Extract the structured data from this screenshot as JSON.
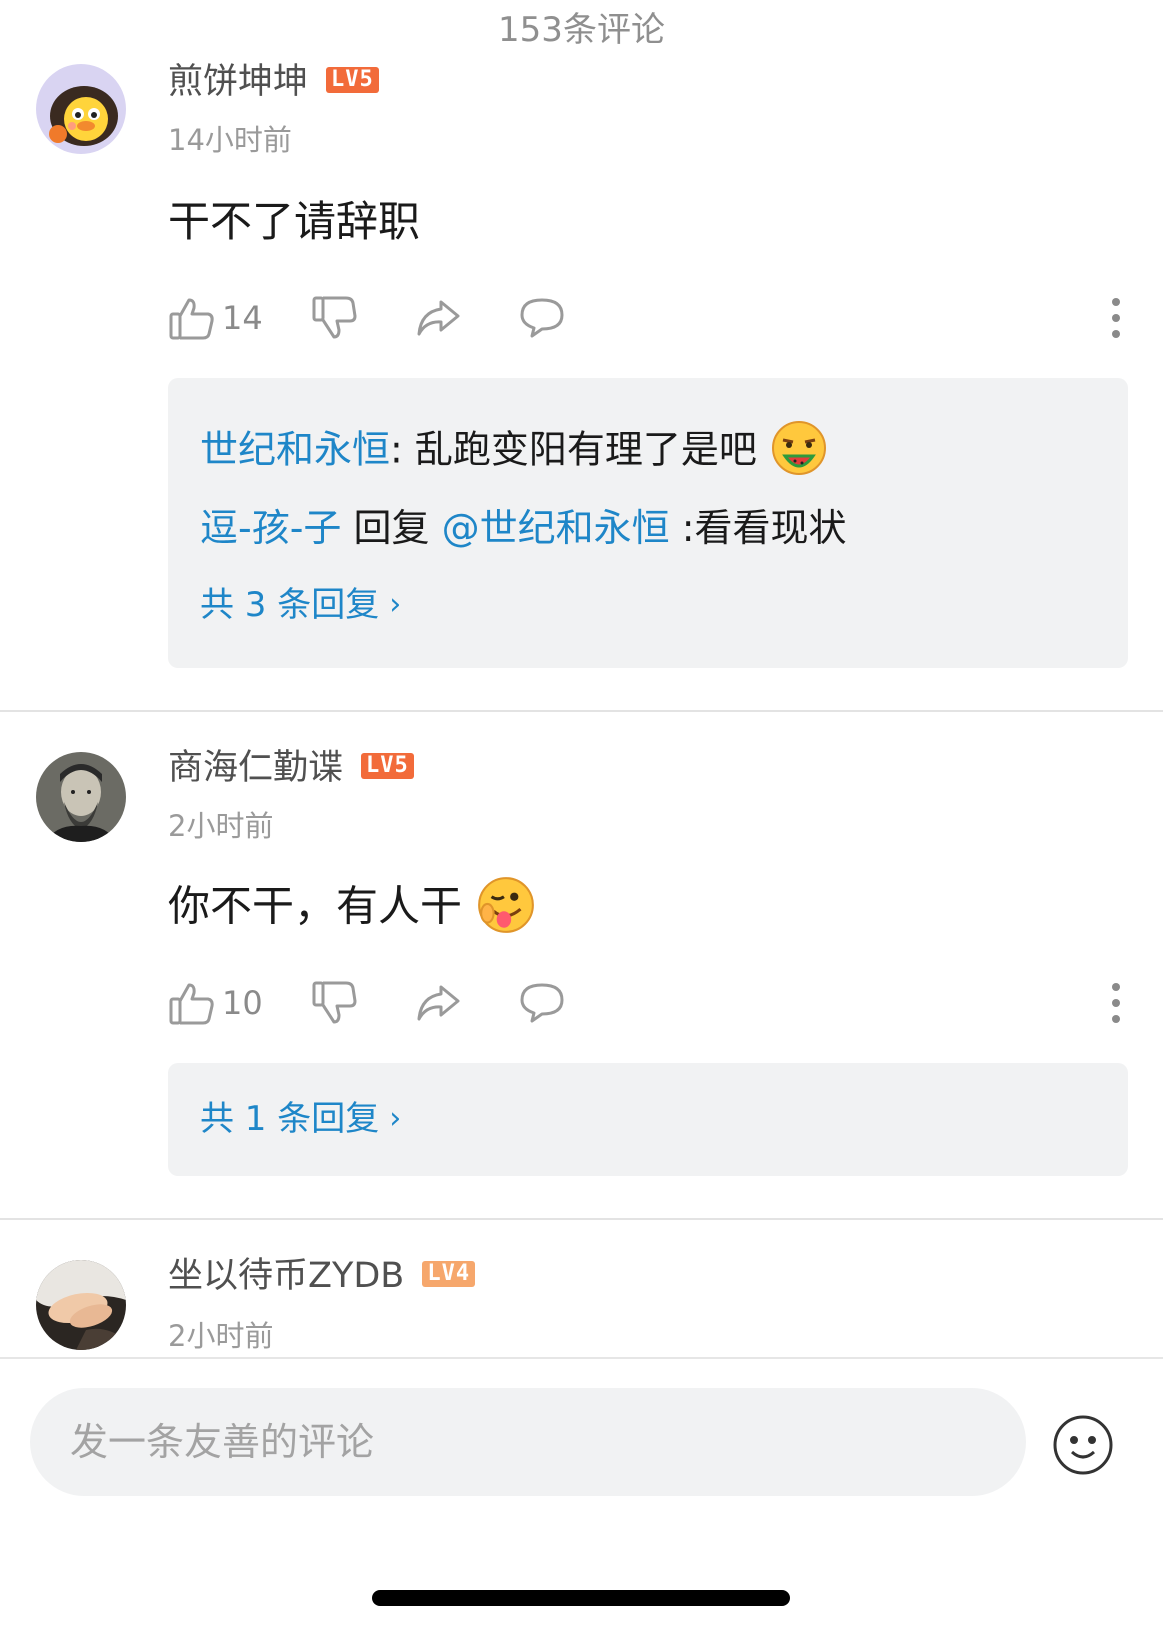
{
  "header": {
    "title": "153条评论"
  },
  "comments": [
    {
      "username": "煎饼坤坤",
      "level": "LV5",
      "time": "14小时前",
      "content": "干不了请辞职",
      "likes": "14",
      "replies": [
        {
          "user": "世纪和永恒",
          "sep": ": ",
          "text": "乱跑变阳有理了是吧"
        },
        {
          "user": "逗-孩-子",
          "action": " 回复 ",
          "target": "@世纪和永恒",
          "text": " :看看现状"
        }
      ],
      "reply_count_label": "共 3 条回复"
    },
    {
      "username": "商海仁勤谍",
      "level": "LV5",
      "time": "2小时前",
      "content": "你不干，有人干",
      "likes": "10",
      "reply_count_label": "共 1 条回复"
    },
    {
      "username": "坐以待币ZYDB",
      "level": "LV4",
      "time": "2小时前"
    }
  ],
  "footer": {
    "input_placeholder": "发一条友善的评论"
  },
  "colors": {
    "link": "#1e86c8",
    "level5": "#f26b3a",
    "level4": "#f6a76c",
    "reply_bg": "#f1f2f3"
  },
  "icons": [
    "thumbs-up-icon",
    "thumbs-down-icon",
    "share-icon",
    "comment-icon",
    "more-vertical-icon",
    "emoji-icon"
  ]
}
